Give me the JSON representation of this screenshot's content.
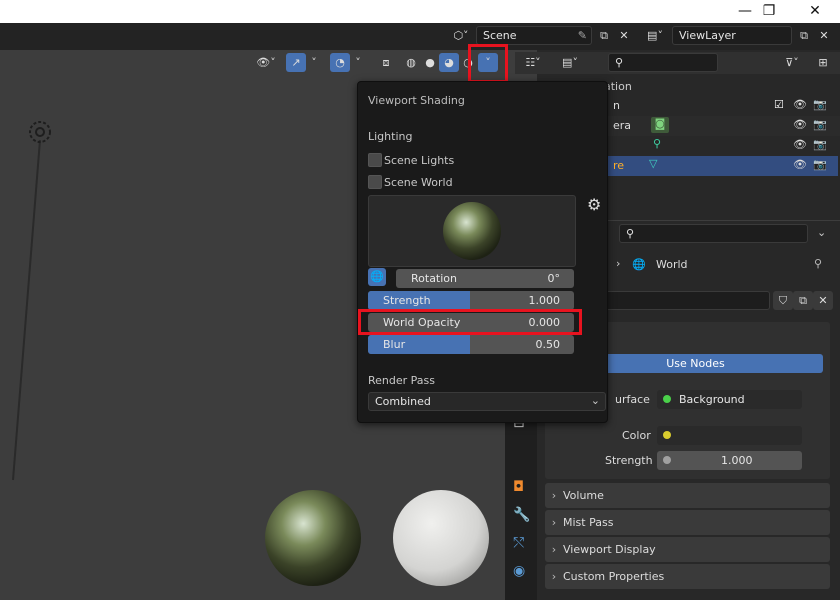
{
  "window": {
    "minimize": "—",
    "maximize": "❐",
    "close": "✕"
  },
  "topbar": {
    "scene_name": "Scene",
    "view_layer": "ViewLayer"
  },
  "popover": {
    "title": "Viewport Shading",
    "lighting_label": "Lighting",
    "scene_lights": "Scene Lights",
    "scene_world": "Scene World",
    "scene_lights_checked": false,
    "scene_world_checked": false,
    "rotation_label": "Rotation",
    "rotation_value": "0°",
    "strength_label": "Strength",
    "strength_value": "1.000",
    "world_opacity_label": "World Opacity",
    "world_opacity_value": "0.000",
    "blur_label": "Blur",
    "blur_value": "0.50",
    "render_pass_label": "Render Pass",
    "render_pass_value": "Combined"
  },
  "outliner": {
    "header_fragment": "ation",
    "rows": [
      {
        "name": "n"
      },
      {
        "name": "era"
      },
      {
        "name": ""
      },
      {
        "name": "re"
      }
    ]
  },
  "properties": {
    "breadcrumb": "World",
    "use_nodes": "Use Nodes",
    "surface_label": "urface",
    "surface_value": "Background",
    "color_label": "Color",
    "strength_label": "Strength",
    "strength_value": "1.000",
    "panels": [
      "Volume",
      "Mist Pass",
      "Viewport Display",
      "Custom Properties"
    ]
  },
  "colors": {
    "accent": "#4772b3",
    "highlight": "#e8131f",
    "selected_row": "#334d80"
  }
}
